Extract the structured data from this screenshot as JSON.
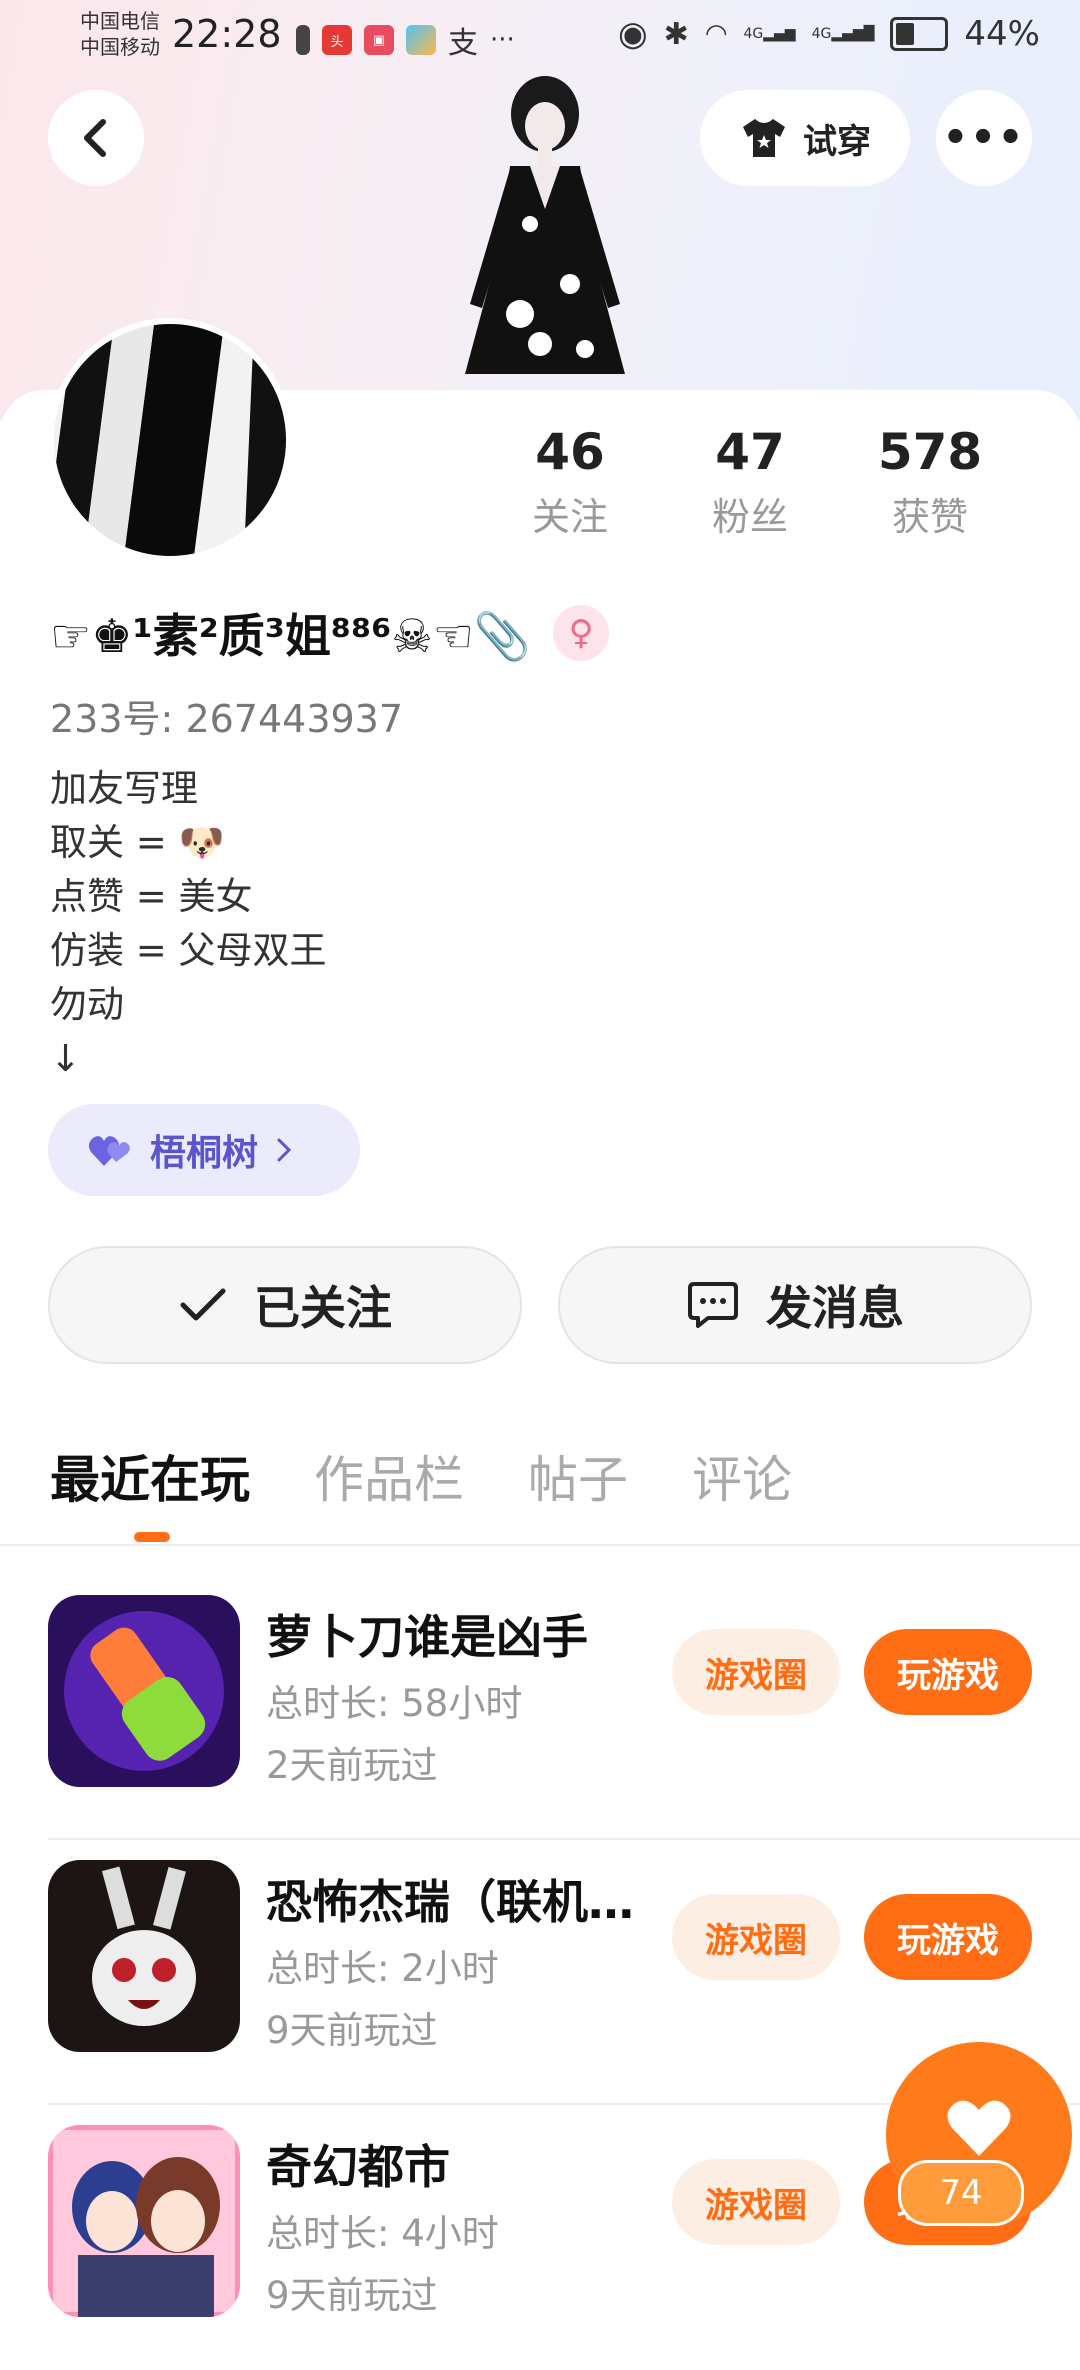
{
  "status_bar": {
    "carrier1": "中国电信",
    "carrier2": "中国移动",
    "time": "22:28",
    "network1": "4G",
    "network2": "4G",
    "battery": "44%"
  },
  "header": {
    "tryon_label": "试穿",
    "more_label": "•••"
  },
  "profile": {
    "stats": [
      {
        "value": "46",
        "label": "关注"
      },
      {
        "value": "47",
        "label": "粉丝"
      },
      {
        "value": "578",
        "label": "获赞"
      }
    ],
    "username": "☞♚¹素²质³姐⁸⁸⁶☠☜📎",
    "gender_symbol": "♀",
    "uid_label": "233号:",
    "uid_value": "267443937",
    "bio_lines": [
      "加友写理",
      "取关 = 🐶",
      "点赞 = 美女",
      "仿装 = 父母双王",
      "勿动",
      "↓"
    ],
    "tag_label": "梧桐树"
  },
  "actions": {
    "follow_label": "已关注",
    "message_label": "发消息"
  },
  "tabs": [
    "最近在玩",
    "作品栏",
    "帖子",
    "评论"
  ],
  "games": [
    {
      "name": "萝卜刀谁是凶手",
      "duration_label": "总时长:",
      "duration": "58小时",
      "last_played": "2天前玩过",
      "circle_label": "游戏圈",
      "play_label": "玩游戏"
    },
    {
      "name": "恐怖杰瑞（联机…",
      "duration_label": "总时长:",
      "duration": "2小时",
      "last_played": "9天前玩过",
      "circle_label": "游戏圈",
      "play_label": "玩游戏"
    },
    {
      "name": "奇幻都市",
      "duration_label": "总时长:",
      "duration": "4小时",
      "last_played": "9天前玩过",
      "circle_label": "游戏圈",
      "play_label": "玩游戏"
    }
  ],
  "like_fab": {
    "count": "74"
  }
}
